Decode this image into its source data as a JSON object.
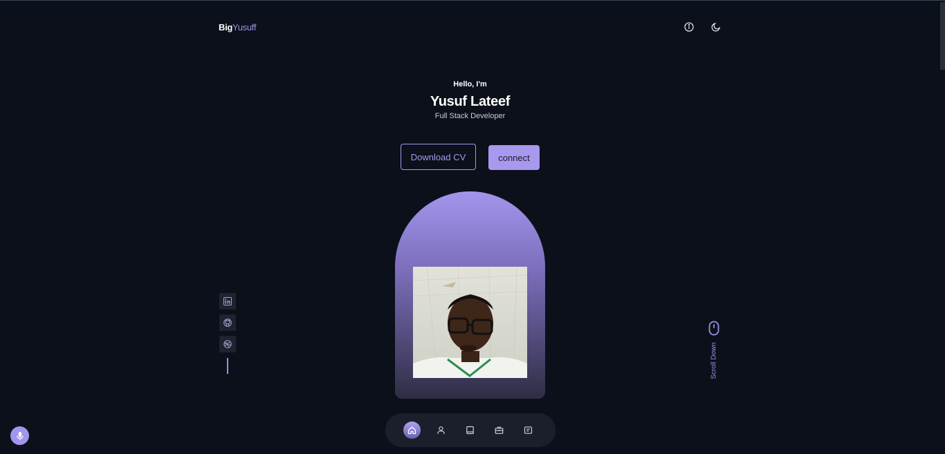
{
  "header": {
    "logo_primary": "Big",
    "logo_accent": "Yusuff",
    "icons": [
      "info-icon",
      "moon-icon"
    ]
  },
  "hero": {
    "greeting": "Hello, I'm",
    "name": "Yusuf Lateef",
    "role": "Full Stack Developer",
    "download_cv_label": "Download CV",
    "connect_label": "connect"
  },
  "socials": [
    "linkedin-icon",
    "github-icon",
    "dribbble-icon"
  ],
  "scroll": {
    "label": "Scroll Down"
  },
  "nav": {
    "items": [
      "home",
      "about",
      "experience",
      "portfolio",
      "contact"
    ],
    "active": "home"
  },
  "colors": {
    "background": "#0c101b",
    "accent": "#a898ee",
    "nav_background": "#1b1f2b"
  }
}
